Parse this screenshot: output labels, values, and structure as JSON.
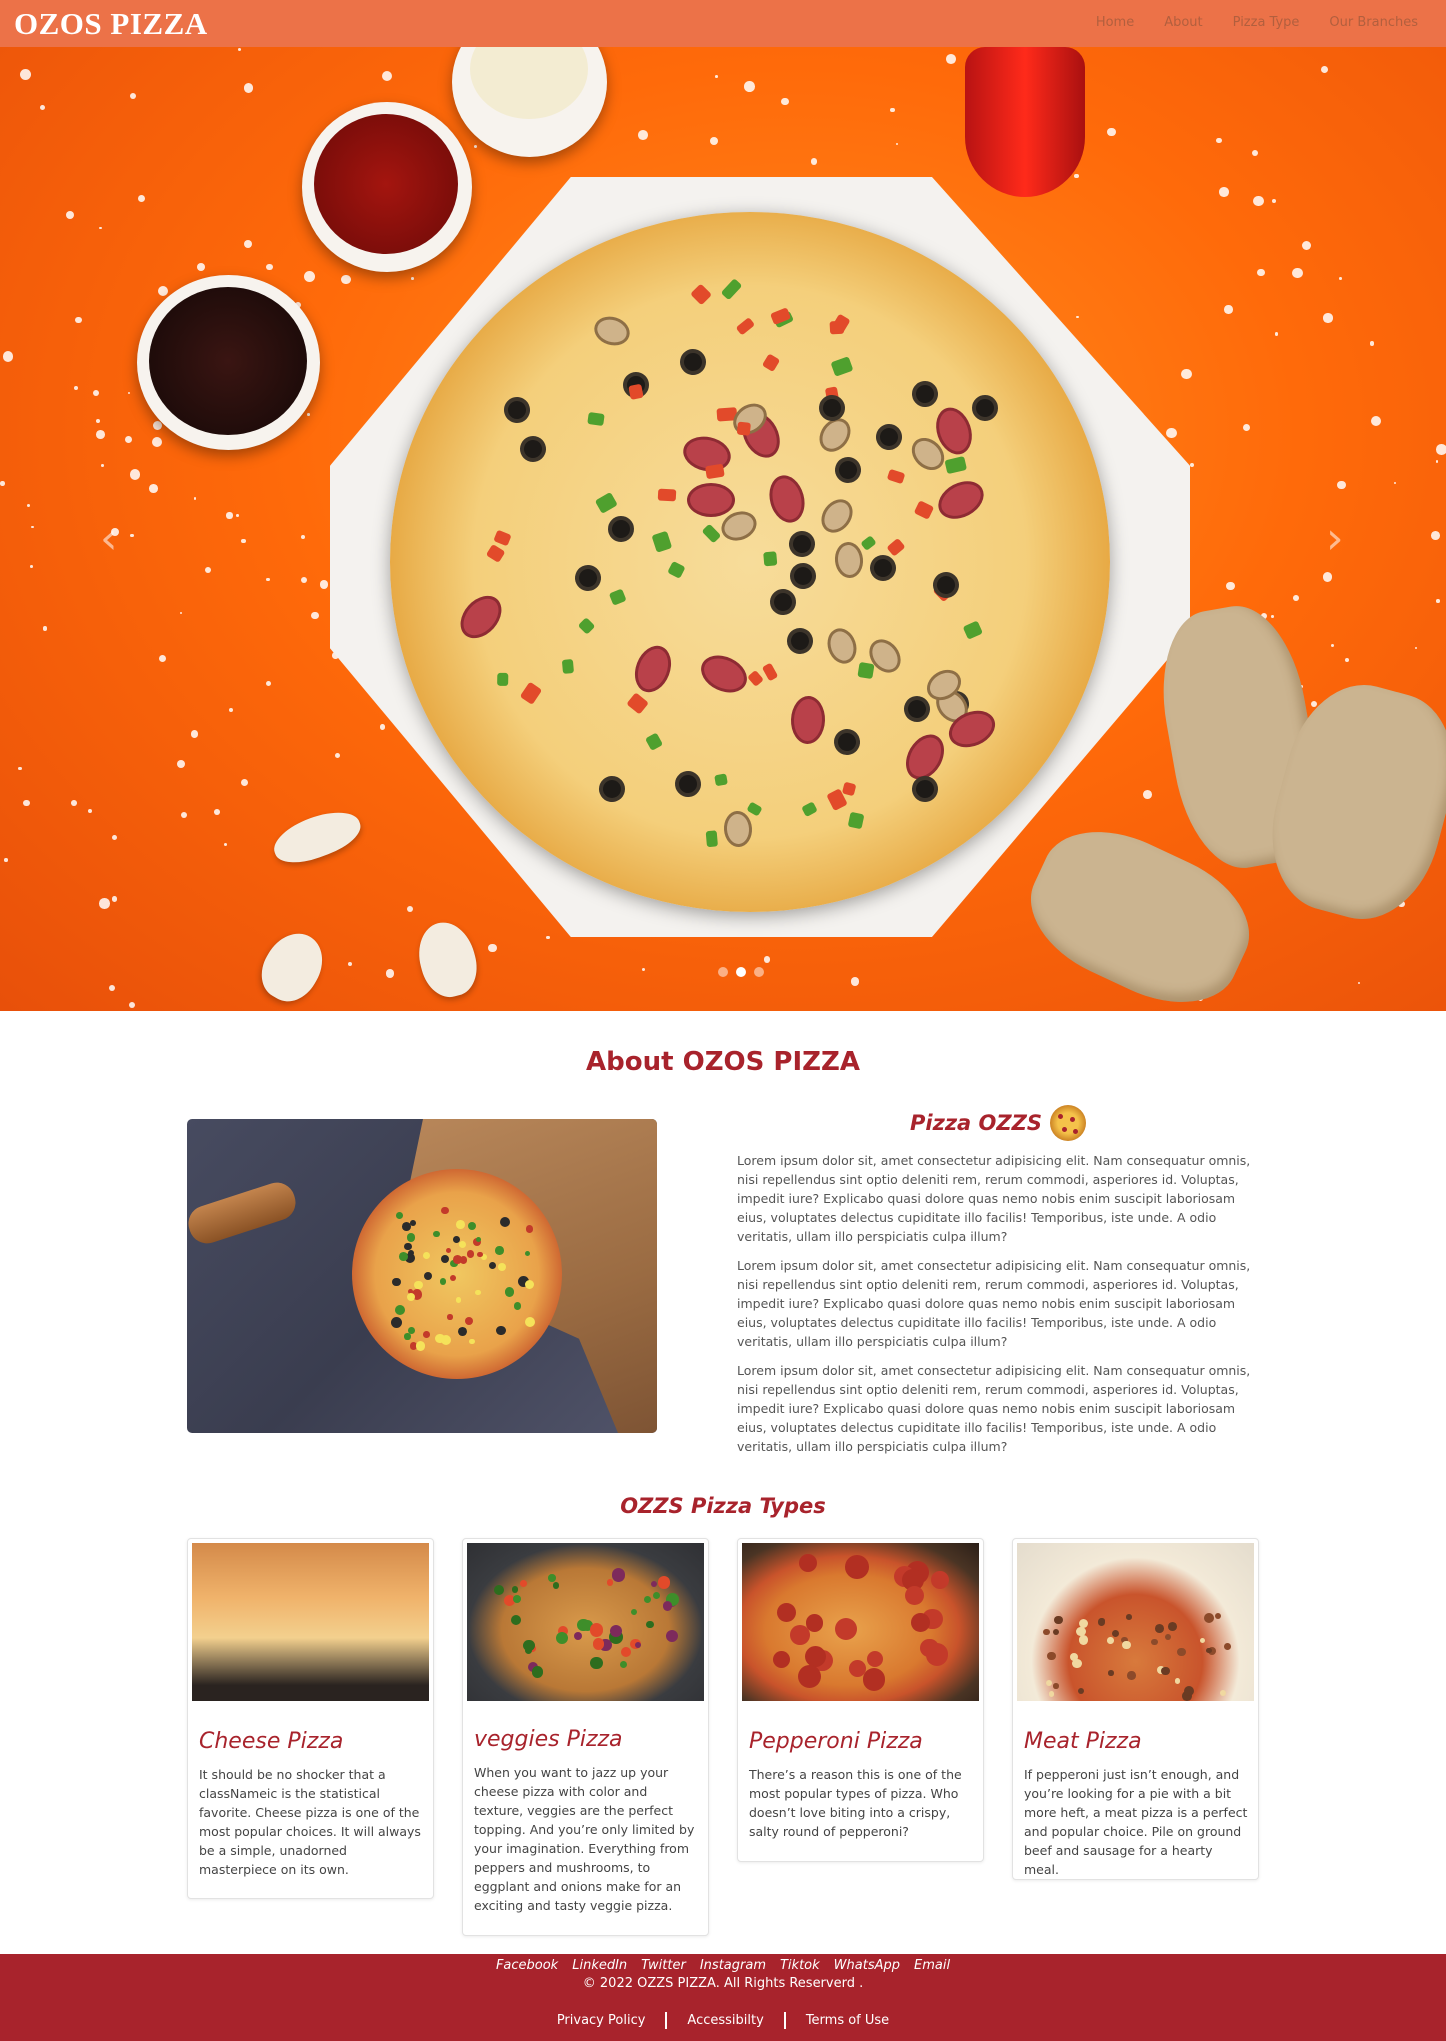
{
  "navbar": {
    "brand": "OZOS PIZZA",
    "links": [
      "Home",
      "About",
      "Pizza Type",
      "Our Branches"
    ]
  },
  "hero": {
    "prev_icon": "chevron-left-icon",
    "next_icon": "chevron-right-icon",
    "prev_glyph": "‹",
    "next_glyph": "›",
    "slide_count": 3,
    "active_slide": 2
  },
  "about": {
    "title": "About OZOS PIZZA",
    "subtitle": "Pizza OZZS",
    "paragraphs": [
      "Lorem ipsum dolor sit, amet consectetur adipisicing elit. Nam consequatur omnis, nisi repellendus sint optio deleniti rem, rerum commodi, asperiores id. Voluptas, impedit iure? Explicabo quasi dolore quas nemo nobis enim suscipit laboriosam eius, voluptates delectus cupiditate illo facilis! Temporibus, iste unde. A odio veritatis, ullam illo perspiciatis culpa illum?",
      "Lorem ipsum dolor sit, amet consectetur adipisicing elit. Nam consequatur omnis, nisi repellendus sint optio deleniti rem, rerum commodi, asperiores id. Voluptas, impedit iure? Explicabo quasi dolore quas nemo nobis enim suscipit laboriosam eius, voluptates delectus cupiditate illo facilis! Temporibus, iste unde. A odio veritatis, ullam illo perspiciatis culpa illum?",
      "Lorem ipsum dolor sit, amet consectetur adipisicing elit. Nam consequatur omnis, nisi repellendus sint optio deleniti rem, rerum commodi, asperiores id. Voluptas, impedit iure? Explicabo quasi dolore quas nemo nobis enim suscipit laboriosam eius, voluptates delectus cupiditate illo facilis! Temporibus, iste unde. A odio veritatis, ullam illo perspiciatis culpa illum?"
    ]
  },
  "types": {
    "title": "OZZS Pizza Types",
    "cards": [
      {
        "title": "Cheese Pizza",
        "text": "It should be no shocker that a classNameic is the statistical favorite. Cheese pizza is one of the most popular choices. It will always be a simple, unadorned masterpiece on its own."
      },
      {
        "title": "veggies Pizza",
        "text": "When you want to jazz up your cheese pizza with color and texture, veggies are the perfect topping. And you’re only limited by your imagination. Everything from peppers and mushrooms, to eggplant and onions make for an exciting and tasty veggie pizza."
      },
      {
        "title": "Pepperoni Pizza",
        "text": "There’s a reason this is one of the most popular types of pizza. Who doesn’t love biting into a crispy, salty round of pepperoni?"
      },
      {
        "title": "Meat Pizza",
        "text": "If pepperoni just isn’t enough, and you’re looking for a pie with a bit more heft, a meat pizza is a perfect and popular choice. Pile on ground beef and sausage for a hearty meal."
      }
    ]
  },
  "footer": {
    "social": [
      "Facebook",
      "LinkedIn",
      "Twitter",
      "Instagram",
      "Tiktok",
      "WhatsApp",
      "Email"
    ],
    "copyright": "© 2022 OZZS PIZZA. All Rights Reserverd .",
    "legal": [
      "Privacy Policy",
      "Accessibilty",
      "Terms of Use"
    ]
  },
  "colors": {
    "navbar": "#ec7248",
    "accent": "#a8232c",
    "hero_background": "#ff6a0a"
  }
}
